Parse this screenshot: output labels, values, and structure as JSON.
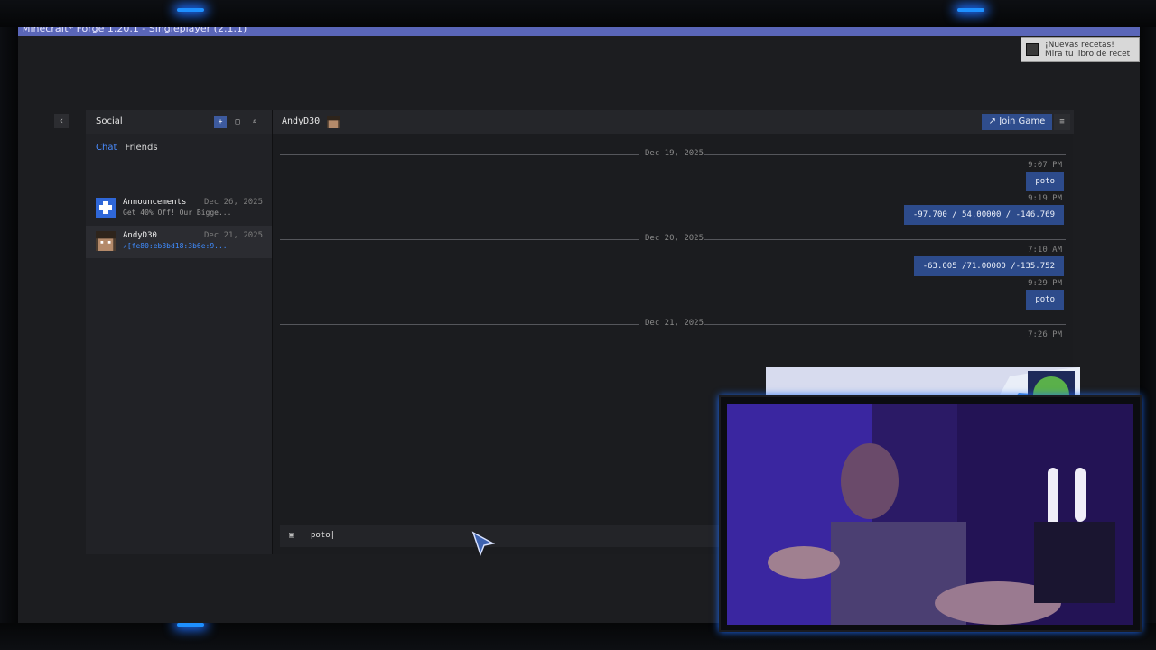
{
  "window": {
    "title": "Minecraft* Forge 1.20.1 - Singleplayer (2.1.1)"
  },
  "toast": {
    "line1": "¡Nuevas recetas!",
    "line2": "Mira tu libro de recet"
  },
  "social": {
    "title": "Social",
    "tabs": [
      {
        "label": "Chat",
        "active": true
      },
      {
        "label": "Friends",
        "active": false
      }
    ],
    "conversations": [
      {
        "name": "Announcements",
        "date": "Dec 26, 2025",
        "preview": "Get 40% Off! Our Bigge..."
      },
      {
        "name": "AndyD30",
        "date": "Dec 21, 2025",
        "preview": "↗[fe80:eb3bd18:3b6e:9..."
      }
    ]
  },
  "chat": {
    "contact": "AndyD30",
    "join_label": "↗ Join Game",
    "groups": [
      {
        "date": "Dec 19, 2025",
        "messages": [
          {
            "time": "9:07 PM",
            "text": "poto"
          },
          {
            "time": "9:19 PM",
            "text": "-97.700 / 54.00000 / -146.769"
          }
        ]
      },
      {
        "date": "Dec 20, 2025",
        "messages": [
          {
            "time": "7:10 AM",
            "text": "-63.005 /71.00000 /-135.752"
          },
          {
            "time": "9:29 PM",
            "text": "poto"
          }
        ]
      },
      {
        "date": "Dec 21, 2025",
        "messages": [
          {
            "time": "7:26 PM",
            "text": ""
          }
        ]
      }
    ],
    "composer_value": "poto|"
  },
  "colors": {
    "accent": "#2f4d8d",
    "link": "#3f8cff",
    "titlebar": "#5a66b8"
  },
  "icons": {
    "back": "chevron-left-icon",
    "add_friend": "add-user-icon",
    "new_chat": "new-chat-icon",
    "search": "search-icon",
    "menu": "hamburger-icon",
    "image": "image-icon"
  }
}
